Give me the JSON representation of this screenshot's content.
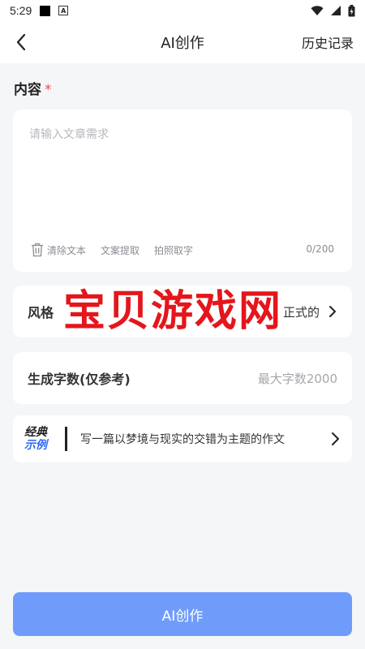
{
  "status_bar": {
    "time": "5:29",
    "icons": [
      "notification-square-icon",
      "a-box-icon",
      "wifi-icon",
      "signal-icon",
      "battery-icon"
    ]
  },
  "header": {
    "back_icon": "chevron-left-icon",
    "title": "AI创作",
    "history": "历史记录"
  },
  "content": {
    "label": "内容",
    "required_mark": "*",
    "placeholder": "请输入文章需求",
    "value": "",
    "tools": {
      "clear": "清除文本",
      "extract": "文案提取",
      "photo": "拍照取字"
    },
    "char_count": "0/200"
  },
  "style": {
    "label": "风格",
    "value": "正式的",
    "chevron_icon": "chevron-right-icon"
  },
  "word_count": {
    "label": "生成字数(仅参考)",
    "placeholder": "最大字数2000"
  },
  "watermark": "宝贝游戏网",
  "example": {
    "badge_line1": "经典",
    "badge_line2": "示例",
    "text": "写一篇以梦境与现实的交错为主题的作文",
    "chevron_icon": "chevron-right-icon"
  },
  "submit": {
    "label": "AI创作"
  },
  "colors": {
    "accent": "#6f9cfb",
    "badge_blue": "#2f6bf2",
    "required": "#f04848",
    "watermark": "#e4161c",
    "background": "#f5f6f8"
  }
}
